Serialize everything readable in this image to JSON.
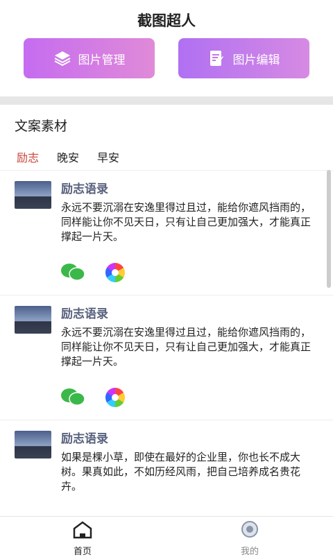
{
  "app": {
    "title": "截图超人"
  },
  "buttons": {
    "manage": "图片管理",
    "edit": "图片编辑"
  },
  "section": {
    "title": "文案素材"
  },
  "tabs": [
    {
      "label": "励志"
    },
    {
      "label": "晚安"
    },
    {
      "label": "早安"
    }
  ],
  "cards": [
    {
      "title": "励志语录",
      "text": "永远不要沉溺在安逸里得过且过，能给你遮风挡雨的，同样能让你不见天日，只有让自己更加强大，才能真正撑起一片天。"
    },
    {
      "title": "励志语录",
      "text": "永远不要沉溺在安逸里得过且过，能给你遮风挡雨的，同样能让你不见天日，只有让自己更加强大，才能真正撑起一片天。"
    },
    {
      "title": "励志语录",
      "text": "如果是棵小草，即使在最好的企业里，你也长不成大树。果真如此，不如历经风雨，把自己培养成名贵花卉。"
    }
  ],
  "nav": {
    "home": "首页",
    "mine": "我的"
  }
}
